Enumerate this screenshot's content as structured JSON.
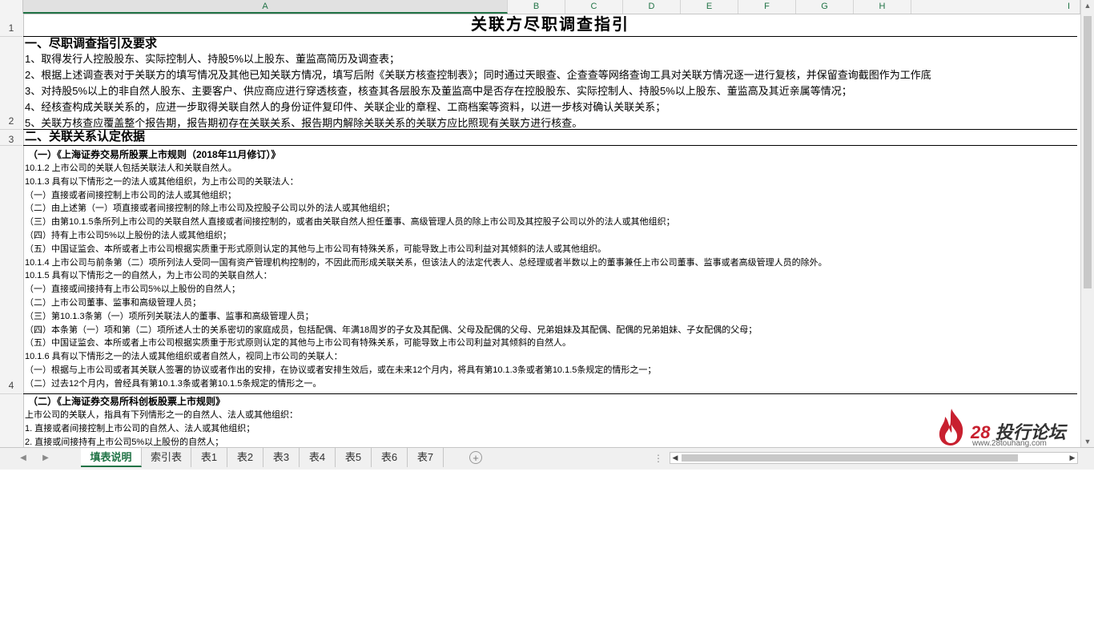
{
  "columns": [
    "A",
    "B",
    "C",
    "D",
    "E",
    "F",
    "G",
    "H",
    "I"
  ],
  "rows": [
    "1",
    "2",
    "3",
    "4"
  ],
  "title": "关联方尽职调查指引",
  "section1": {
    "heading": "一、尽职调查指引及要求",
    "items": [
      "1、取得发行人控股股东、实际控制人、持股5%以上股东、董监高简历及调查表；",
      "2、根据上述调查表对于关联方的填写情况及其他已知关联方情况，填写后附《关联方核查控制表》；同时通过天眼查、企查查等网络查询工具对关联方情况逐一进行复核，并保留查询截图作为工作底",
      "3、对持股5%以上的非自然人股东、主要客户、供应商应进行穿透核查，核查其各层股东及董监高中是否存在控股股东、实际控制人、持股5%以上股东、董监高及其近亲属等情况；",
      "4、经核查构成关联关系的，应进一步取得关联自然人的身份证件复印件、关联企业的章程、工商档案等资料，以进一步核对确认关联关系；",
      "5、关联方核查应覆盖整个报告期，报告期初存在关联关系、报告期内解除关联关系的关联方应比照现有关联方进行核查。"
    ]
  },
  "section2": {
    "heading": "二、关联关系认定依据"
  },
  "block1": {
    "heading": "（一）《上海证券交易所股票上市规则（2018年11月修订）》",
    "lines": [
      "10.1.2 上市公司的关联人包括关联法人和关联自然人。",
      "10.1.3 具有以下情形之一的法人或其他组织，为上市公司的关联法人：",
      "（一）直接或者间接控制上市公司的法人或其他组织；",
      "（二）由上述第（一）项直接或者间接控制的除上市公司及控股子公司以外的法人或其他组织；",
      "（三）由第10.1.5条所列上市公司的关联自然人直接或者间接控制的，或者由关联自然人担任董事、高级管理人员的除上市公司及其控股子公司以外的法人或其他组织；",
      "（四）持有上市公司5%以上股份的法人或其他组织；",
      "（五）中国证监会、本所或者上市公司根据实质重于形式原则认定的其他与上市公司有特殊关系，可能导致上市公司利益对其倾斜的法人或其他组织。",
      "10.1.4 上市公司与前条第（二）项所列法人受同一国有资产管理机构控制的，不因此而形成关联关系，但该法人的法定代表人、总经理或者半数以上的董事兼任上市公司董事、监事或者高级管理人员的除外。",
      "10.1.5 具有以下情形之一的自然人，为上市公司的关联自然人：",
      "（一）直接或间接持有上市公司5%以上股份的自然人；",
      "（二）上市公司董事、监事和高级管理人员；",
      "（三）第10.1.3条第（一）项所列关联法人的董事、监事和高级管理人员；",
      "（四）本条第（一）项和第（二）项所述人士的关系密切的家庭成员，包括配偶、年满18周岁的子女及其配偶、父母及配偶的父母、兄弟姐妹及其配偶、配偶的兄弟姐妹、子女配偶的父母；",
      "（五）中国证监会、本所或者上市公司根据实质重于形式原则认定的其他与上市公司有特殊关系，可能导致上市公司利益对其倾斜的自然人。",
      "10.1.6 具有以下情形之一的法人或其他组织或者自然人，视同上市公司的关联人：",
      "（一）根据与上市公司或者其关联人签署的协议或者作出的安排，在协议或者安排生效后，或在未来12个月内，将具有第10.1.3条或者第10.1.5条规定的情形之一；",
      "（二）过去12个月内，曾经具有第10.1.3条或者第10.1.5条规定的情形之一。"
    ]
  },
  "block2": {
    "heading": "（二）《上海证券交易所科创板股票上市规则》",
    "lines": [
      "上市公司的关联人，指具有下列情形之一的自然人、法人或其他组织：",
      "1. 直接或者间接控制上市公司的自然人、法人或其他组织；",
      "2. 直接或间接持有上市公司5%以上股份的自然人；"
    ]
  },
  "tabs": [
    "填表说明",
    "索引表",
    "表1",
    "表2",
    "表3",
    "表4",
    "表5",
    "表6",
    "表7"
  ],
  "active_tab": "填表说明",
  "logo": {
    "num": "28",
    "text": "投行论坛",
    "url": "www.28touhang.com"
  },
  "colors": {
    "accent": "#217346",
    "brand_red": "#c8202f"
  }
}
